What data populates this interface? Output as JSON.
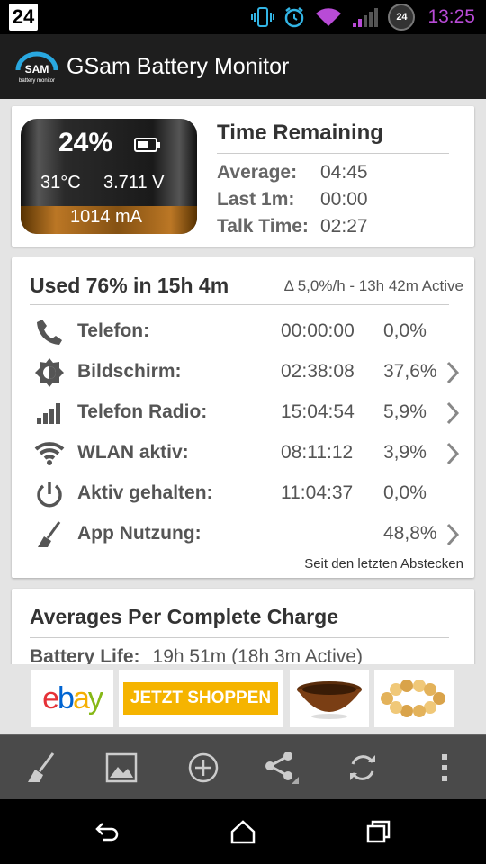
{
  "status_bar": {
    "badge": "24",
    "calendar_badge": "24",
    "time": "13:25",
    "icons": [
      "vibrate-icon",
      "alarm-icon",
      "wifi-icon",
      "signal-icon",
      "calendar-icon"
    ],
    "time_color": "#b84bd6"
  },
  "app": {
    "title": "GSam Battery Monitor",
    "logo_text": "SAM",
    "logo_subtext": "battery monitor"
  },
  "battery": {
    "percent": "24%",
    "level": 0.24,
    "temperature": "31°C",
    "voltage": "3.711 V",
    "current": "1014 mA"
  },
  "time_remaining": {
    "title": "Time Remaining",
    "rows": [
      {
        "label": "Average:",
        "value": "04:45"
      },
      {
        "label": "Last 1m:",
        "value": "00:00"
      },
      {
        "label": "Talk Time:",
        "value": "02:27"
      }
    ]
  },
  "usage": {
    "title": "Used 76% in 15h 4m",
    "rate": "Δ 5,0%/h - 13h 42m Active",
    "rows": [
      {
        "icon": "phone-icon",
        "label": "Telefon:",
        "time": "00:00:00",
        "percent": "0,0%",
        "chevron": false
      },
      {
        "icon": "brightness-icon",
        "label": "Bildschirm:",
        "time": "02:38:08",
        "percent": "37,6%",
        "chevron": true
      },
      {
        "icon": "signal-bars-icon",
        "label": "Telefon Radio:",
        "time": "15:04:54",
        "percent": "5,9%",
        "chevron": true
      },
      {
        "icon": "wifi-icon",
        "label": "WLAN aktiv:",
        "time": "08:11:12",
        "percent": "3,9%",
        "chevron": true
      },
      {
        "icon": "power-icon",
        "label": "Aktiv gehalten:",
        "time": "11:04:37",
        "percent": "0,0%",
        "chevron": false
      },
      {
        "icon": "broom-icon",
        "label": "App Nutzung:",
        "time": "",
        "percent": "48,8%",
        "chevron": true
      }
    ],
    "since": "Seit den letzten Abstecken"
  },
  "averages": {
    "title": "Averages Per Complete Charge",
    "row_label": "Battery Life:",
    "row_value": "19h 51m (18h 3m Active)"
  },
  "ads": {
    "ebay": "ebay",
    "shop_button": "JETZT SHOPPEN"
  },
  "toolbar": {
    "buttons": [
      "broom-icon",
      "image-icon",
      "add-circle-icon",
      "share-icon",
      "refresh-icon",
      "overflow-menu-icon"
    ]
  },
  "navbar": {
    "buttons": [
      "back-icon",
      "home-icon",
      "recents-icon"
    ]
  }
}
